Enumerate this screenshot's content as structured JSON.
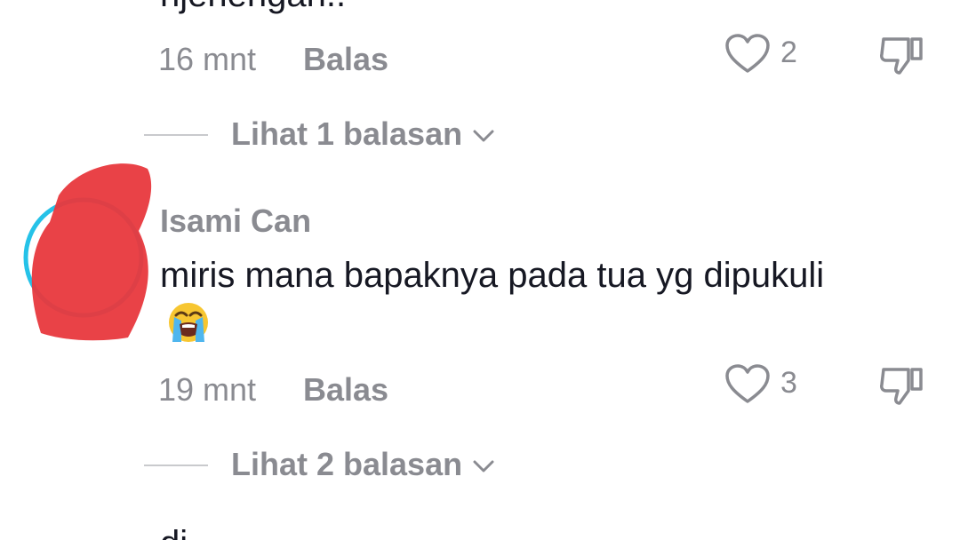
{
  "top_comment": {
    "cut_text": "njenengan..",
    "time": "16 mnt",
    "reply_label": "Balas",
    "like_count": "2",
    "view_replies": "Lihat 1 balasan"
  },
  "comment": {
    "username": "Isami Can",
    "text": "miris mana bapaknya pada tua yg dipukuli",
    "emoji": "loudly-crying-face",
    "time": "19 mnt",
    "reply_label": "Balas",
    "like_count": "3",
    "view_replies": "Lihat 2 balasan"
  },
  "bottom_cut_text": "di",
  "colors": {
    "primary_text": "#161823",
    "secondary_text": "#8a8b91",
    "divider": "#c9cacd",
    "avatar_ring": "#25c2e8",
    "redaction": "#e8383d"
  }
}
